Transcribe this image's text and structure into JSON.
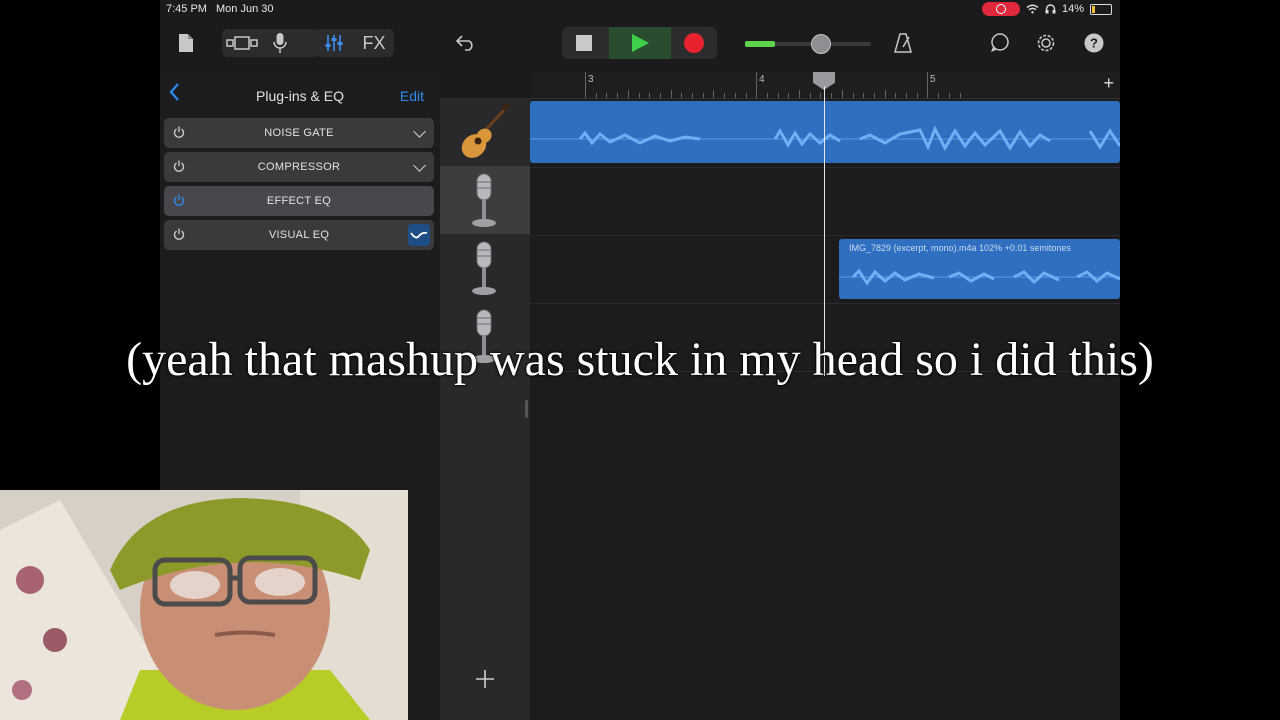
{
  "status_bar": {
    "time": "7:45 PM",
    "date": "Mon Jun 30",
    "battery": "14%"
  },
  "toolbar": {
    "fx_label": "FX"
  },
  "plugins_panel": {
    "title": "Plug-ins & EQ",
    "edit_label": "Edit",
    "plugins": [
      {
        "name": "NOISE GATE",
        "power_on": false,
        "expandable": true
      },
      {
        "name": "COMPRESSOR",
        "power_on": false,
        "expandable": true
      },
      {
        "name": "EFFECT EQ",
        "power_on": true,
        "expandable": false
      },
      {
        "name": "VISUAL EQ",
        "power_on": false,
        "expandable": false
      }
    ]
  },
  "timeline": {
    "bar_numbers": [
      "3",
      "4",
      "5"
    ],
    "tracks": [
      {
        "instrument": "acoustic-guitar-icon"
      },
      {
        "instrument": "microphone-icon",
        "selected": true
      },
      {
        "instrument": "microphone-icon"
      },
      {
        "instrument": "microphone-icon"
      }
    ],
    "region_label": "IMG_7829 (excerpt, mono).m4a 102% +0.01 semitones"
  },
  "caption": "(yeah that mashup was stuck in my head so i did this)",
  "colors": {
    "accent": "#2d8cf0",
    "region": "#2f6fbf",
    "play": "#3fd04a",
    "record": "#e8232f"
  }
}
